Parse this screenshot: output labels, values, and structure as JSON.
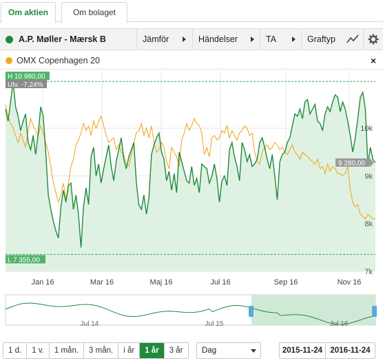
{
  "tabs": [
    {
      "label": "Om aktien",
      "active": true
    },
    {
      "label": "Om bolaget",
      "active": false
    }
  ],
  "toolbar": {
    "stock_name": "A.P. Møller - Mærsk B",
    "compare": "Jämför",
    "events": "Händelser",
    "ta": "TA",
    "chart_type": "Graftyp",
    "settings_icon": "gear-icon",
    "chart_type_icon": "line-chart-icon"
  },
  "legend": {
    "series_name": "OMX Copenhagen 20",
    "close_glyph": "×"
  },
  "colors": {
    "stock": "#1f8a3b",
    "index": "#f2a826",
    "fill": "#dff1e3",
    "active": "#1f8a3b"
  },
  "chart_data": {
    "type": "line",
    "x_ticks": [
      "Jan 16",
      "Mar 16",
      "Maj 16",
      "Jul 16",
      "Sep 16",
      "Nov 16"
    ],
    "y_ticks": [
      "10k",
      "9k",
      "8k",
      "7k"
    ],
    "ylim": [
      7000,
      11200
    ],
    "high_label": "H 10 980,00",
    "change_label": "Utv. -7,24%",
    "low_label": "L 7 355,00",
    "last_label": "9 280,00",
    "series": [
      {
        "name": "A.P. Møller - Mærsk B",
        "values": [
          10400,
          10150,
          10550,
          10980,
          10450,
          10250,
          9950,
          10150,
          10300,
          9700,
          9550,
          9850,
          9450,
          9900,
          10450,
          10250,
          9500,
          8600,
          8300,
          8050,
          7850,
          7700,
          8350,
          8700,
          8450,
          8800,
          8850,
          8300,
          8600,
          8200,
          7500,
          8350,
          8750,
          8400,
          9400,
          9600,
          9000,
          9250,
          8850,
          9150,
          9400,
          9650,
          9200,
          8900,
          9300,
          9550,
          9800,
          9350,
          9150,
          9400,
          9550,
          9700,
          8850,
          8400,
          8300,
          8600,
          8200,
          8550,
          9450,
          9650,
          9800,
          9900,
          9500,
          9350,
          8900,
          9100,
          8700,
          9050,
          8650,
          9500,
          9300,
          9100,
          8900,
          8850,
          9200,
          8800,
          8950,
          8650,
          9250,
          9200,
          9150,
          8850,
          9000,
          9250,
          8950,
          8450,
          8900,
          9000,
          8800,
          9550,
          9700,
          9400,
          9200,
          8900,
          9700,
          9550,
          9300,
          9450,
          9200,
          9250,
          9350,
          9700,
          9800,
          9600,
          9350,
          9150,
          9450,
          9000,
          8500,
          9300,
          9450,
          9500,
          9700,
          9800,
          10050,
          10300,
          10250,
          10400,
          10200,
          10550,
          10600,
          10300,
          10400,
          10500,
          10150,
          10100,
          9950,
          10300,
          10450,
          10350,
          10550,
          10700,
          10650,
          10350,
          10550,
          10400,
          10150,
          9850,
          9500,
          9800,
          10200,
          10650,
          10750,
          10400,
          9250,
          9600,
          9350,
          9280
        ]
      },
      {
        "name": "OMX Copenhagen 20",
        "values": [
          10500,
          10250,
          10100,
          10000,
          9850,
          9700,
          9900,
          9750,
          9600,
          9950,
          10200,
          10050,
          9950,
          9850,
          10050,
          9900,
          9700,
          9500,
          9200,
          8850,
          8650,
          8450,
          8600,
          8850,
          8500,
          8850,
          9200,
          9350,
          9650,
          9750,
          9900,
          10100,
          9950,
          10050,
          9850,
          10150,
          10000,
          10150,
          10250,
          10050,
          9850,
          9700,
          9750,
          9800,
          9550,
          9650,
          9500,
          9450,
          9250,
          9200,
          9450,
          9700,
          9900,
          9950,
          10100,
          9850,
          10000,
          9800,
          10050,
          9700,
          9500,
          9550,
          9700,
          9600,
          9300,
          9150,
          9600,
          9500,
          9400,
          9200,
          9750,
          9900,
          10100,
          9950,
          10050,
          10200,
          10100,
          10050,
          9900,
          9450,
          9600,
          9400,
          9800,
          9850,
          9750,
          9800,
          9950,
          9900,
          10050,
          9800,
          9950,
          9850,
          9750,
          9900,
          9950,
          10050,
          10000,
          9850,
          9900,
          9500,
          9300,
          9250,
          9500,
          9600,
          9650,
          9550,
          9600,
          9700,
          9650,
          9550,
          9600,
          9500,
          9450,
          9550,
          9650,
          9500,
          9450,
          9350,
          9500,
          9450,
          9400,
          9350,
          9300,
          9250,
          9350,
          9150,
          9200,
          9050,
          9250,
          9100,
          9200,
          9150,
          9050,
          9050,
          9000,
          9050,
          9200,
          8700,
          8450,
          8350,
          8400,
          8200,
          8150,
          8100,
          8200,
          8150,
          8100,
          8100
        ]
      }
    ],
    "navigator_ticks": [
      "Jul 14",
      "Jul 15",
      "Jul 16"
    ]
  },
  "controls": {
    "ranges": [
      "1 d.",
      "1 v.",
      "1 mån.",
      "3 mån.",
      "i år",
      "1 år",
      "3 år"
    ],
    "active_range": "1 år",
    "interval": "Dag",
    "date_from": "2015-11-24",
    "date_to": "2016-11-24"
  }
}
